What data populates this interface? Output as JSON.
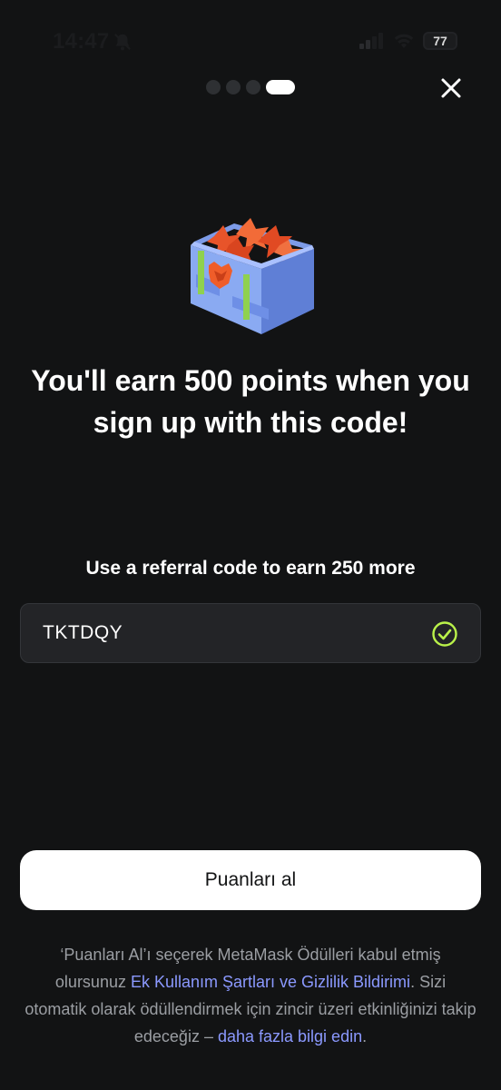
{
  "status_bar": {
    "time": "14:47",
    "battery": "77",
    "battery_fraction": 0.77,
    "bell_icon": "bell-slash-icon",
    "signal_icon": "signal-icon",
    "wifi_icon": "wifi-icon"
  },
  "pager": {
    "total": 4,
    "active_index": 3
  },
  "close_icon": "close-icon",
  "hero_icon": "reward-box-icon",
  "headline": "You'll earn 500 points when you sign up with this code!",
  "referral": {
    "label": "Use a referral code to earn 250 more",
    "code": "TKTDQY",
    "valid_icon": "check-circle-icon"
  },
  "cta": {
    "label": "Puanları al"
  },
  "legal": {
    "text_1": "‘Puanları Al’ı seçerek MetaMask Ödülleri kabul etmiş olursunuz ",
    "link_terms": "Ek Kullanım Şartları ve Gizlilik Bildirimi",
    "text_2": ". Sizi otomatik olarak ödüllendirmek için zincir üzeri etkinliğinizi takip edeceğiz – ",
    "link_more": "daha fazla bilgi edin",
    "text_3": "."
  },
  "colors": {
    "background": "#121314",
    "link": "#8b99ff",
    "success": "#baf24a",
    "button_bg": "#ffffff"
  }
}
